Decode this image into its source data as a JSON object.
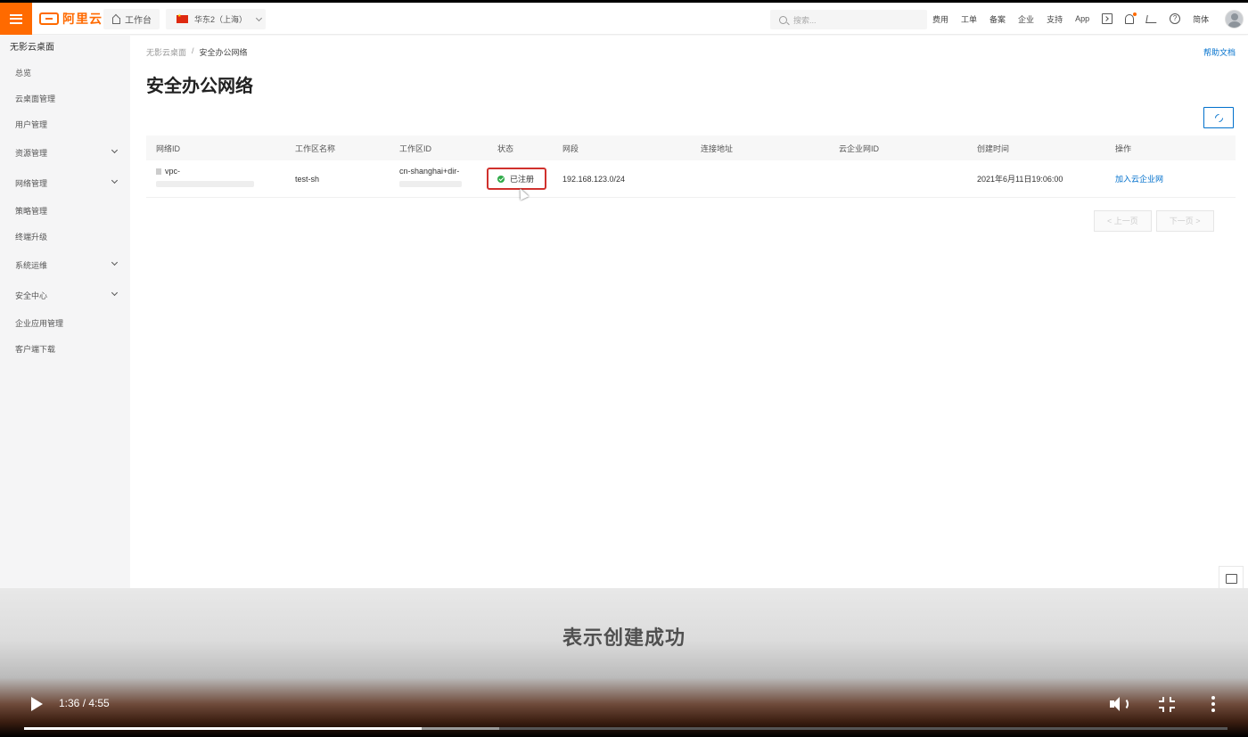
{
  "topbar": {
    "logo_text": "阿里云",
    "workbench_label": "工作台",
    "region_label": "华东2（上海）",
    "search_placeholder": "搜索...",
    "nav": [
      "费用",
      "工单",
      "备案",
      "企业",
      "支持",
      "App"
    ],
    "lang": "简体",
    "accent_color": "#ff6a00"
  },
  "sidebar": {
    "title": "无影云桌面",
    "items": [
      {
        "label": "总览",
        "expandable": false
      },
      {
        "label": "云桌面管理",
        "expandable": false
      },
      {
        "label": "用户管理",
        "expandable": false
      },
      {
        "label": "资源管理",
        "expandable": true
      },
      {
        "label": "网络管理",
        "expandable": true
      },
      {
        "label": "策略管理",
        "expandable": false
      },
      {
        "label": "终端升级",
        "expandable": false
      },
      {
        "label": "系统运维",
        "expandable": true
      },
      {
        "label": "安全中心",
        "expandable": true
      },
      {
        "label": "企业应用管理",
        "expandable": false
      },
      {
        "label": "客户端下载",
        "expandable": false
      }
    ]
  },
  "main": {
    "breadcrumb": [
      "无影云桌面",
      "安全办公网络"
    ],
    "help_link": "帮助文档",
    "page_title": "安全办公网络",
    "table": {
      "headers": [
        "网络ID",
        "工作区名称",
        "工作区ID",
        "状态",
        "网段",
        "连接地址",
        "云企业网ID",
        "创建时间",
        "操作"
      ],
      "rows": [
        {
          "network_id": "vpc-",
          "workspace_name": "test-sh",
          "workspace_id": "cn-shanghai+dir-",
          "status": "已注册",
          "cidr": "192.168.123.0/24",
          "connect_addr": "",
          "cen_id": "",
          "created": "2021年6月11日19:06:00",
          "action": "加入云企业网"
        }
      ]
    },
    "pager": {
      "prev": "< 上一页",
      "next": "下一页 >"
    },
    "status_color": "#2fab4a",
    "link_color": "#0070cc"
  },
  "video": {
    "subtitle": "表示创建成功",
    "time": "1:36 / 4:55",
    "played_fraction": 0.33,
    "buffered_fraction": 0.395
  }
}
